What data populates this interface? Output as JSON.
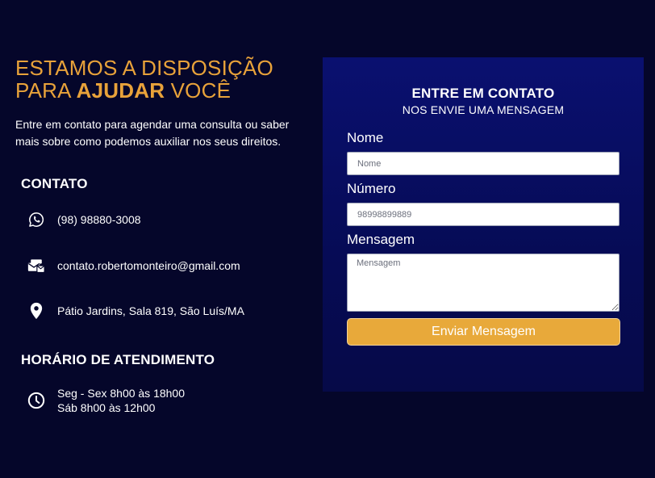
{
  "hero": {
    "title_line1": "ESTAMOS A DISPOSIÇÃO",
    "title_line2_prefix": "PARA ",
    "title_line2_bold": "AJUDAR",
    "title_line2_suffix": " VOCÊ",
    "intro": "Entre em contato para agendar uma consulta ou saber mais sobre como podemos auxiliar nos seus direitos."
  },
  "contact": {
    "title": "CONTATO",
    "items": [
      {
        "icon": "whatsapp-icon",
        "text": "(98) 98880-3008"
      },
      {
        "icon": "mail-icon",
        "text": "contato.robertomonteiro@gmail.com"
      },
      {
        "icon": "location-pin-icon",
        "text": "Pátio Jardins, Sala 819, São Luís/MA"
      }
    ]
  },
  "hours": {
    "title": "HORÁRIO DE ATENDIMENTO",
    "icon": "clock-icon",
    "line1": "Seg - Sex 8h00 às 18h00",
    "line2": "Sáb 8h00 às 12h00"
  },
  "form": {
    "title": "ENTRE EM CONTATO",
    "subtitle": "NOS ENVIE UMA MENSAGEM",
    "name_label": "Nome",
    "name_placeholder": "Nome",
    "number_label": "Número",
    "number_placeholder": "98998899889",
    "message_label": "Mensagem",
    "message_placeholder": "Mensagem",
    "submit_label": "Enviar Mensagem"
  },
  "colors": {
    "background": "#05062a",
    "accent": "#e8a23a",
    "panel": "#0a1070",
    "button": "#e8a93a"
  }
}
